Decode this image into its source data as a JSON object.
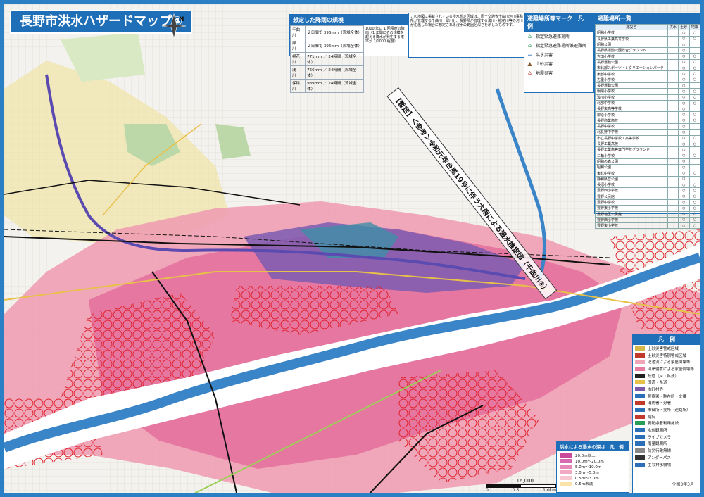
{
  "title": "長野市洪水ハザードマップ④",
  "compass_label": "N",
  "banner": "【暫定】＜参考＞令和元年台風19号に伴う大雨による浸水推定図（千曲川③）",
  "rain_table": {
    "heading": "想定した降雨の規模",
    "rows": [
      [
        "千曲川",
        "２日間で 396mm（流域全体）"
      ],
      [
        "犀　川",
        "２日間で 396mm（流域全体）"
      ],
      [
        "裾花川",
        "771mm ／ 24時間（流域全体）"
      ],
      [
        "浅　川",
        "766mm ／ 24時間（流域全体）"
      ],
      [
        "保科川",
        "989mm ／ 24時間（流域全体）"
      ]
    ],
    "side_note": "1000 年に 1 回程度の降雨（1 年間にその規模を超える降水が発生する確率が 1/1000 程度）"
  },
  "notes_text": "この地図に掲載されている浸水想定区域は、国土交通省千曲川河川事務所が管理する千曲川・犀川と、長野県が管理する浅川・裾花川等の河川が氾濫した場合に想定される浸水の範囲と深さを示したものです。",
  "mark_legend": {
    "heading": "避難場所等マーク　凡　例",
    "items": [
      {
        "label": "指定緊急避難場所",
        "icon": "shelter-icon"
      },
      {
        "label": "指定緊急避難場所兼避難所",
        "icon": "shelter-house-icon"
      }
    ],
    "types": [
      {
        "label": "洪水災害",
        "icon": "flood-icon"
      },
      {
        "label": "土砂災害",
        "icon": "landslide-icon"
      },
      {
        "label": "地震災害",
        "icon": "earthquake-icon"
      }
    ]
  },
  "shelter_list": {
    "heading": "避難場所一覧",
    "columns": [
      "施設名",
      "洪水",
      "土砂",
      "地震"
    ],
    "rows": [
      [
        "昭和小学校",
        "",
        "○",
        "○"
      ],
      [
        "長野県工業高等学校",
        "",
        "○",
        "○"
      ],
      [
        "昭和公園",
        "",
        "○",
        ""
      ],
      [
        "長野県運動公園総合グラウンド",
        "",
        "○",
        ""
      ],
      [
        "吉田小学校",
        "",
        "○",
        "○"
      ],
      [
        "長野運動公園",
        "",
        "○",
        "○"
      ],
      [
        "市北部スポーツ・レクリエーションパーク",
        "",
        "○",
        "○"
      ],
      [
        "東部中学校",
        "",
        "○",
        "○"
      ],
      [
        "古里小学校",
        "",
        "○",
        "○"
      ],
      [
        "長野運動公園",
        "",
        "○",
        ""
      ],
      [
        "朝陽小学校",
        "",
        "○",
        "○"
      ],
      [
        "浅川小学校",
        "",
        "○",
        "○"
      ],
      [
        "北部中学校",
        "",
        "○",
        "○"
      ],
      [
        "長野東高等学校",
        "",
        "○",
        ""
      ],
      [
        "柳原小学校",
        "",
        "○",
        "○"
      ],
      [
        "長野商業高校",
        "",
        "○",
        "○"
      ],
      [
        "長野中学校",
        "",
        "○",
        ""
      ],
      [
        "北長野中学校",
        "",
        "○",
        ""
      ],
      [
        "市立長野中学校・高等学校",
        "",
        "○",
        "○"
      ],
      [
        "長野工業高校",
        "",
        "○",
        "○"
      ],
      [
        "長野工業高等専門学校グラウンド",
        "",
        "○",
        ""
      ],
      [
        "三輪小学校",
        "",
        "○",
        "○"
      ],
      [
        "昭和の森公園",
        "",
        "○",
        ""
      ],
      [
        "昭和公園",
        "",
        "○",
        ""
      ],
      [
        "東北中学校",
        "",
        "○",
        "○"
      ],
      [
        "静和県営公園",
        "",
        "○",
        ""
      ],
      [
        "長沼小学校",
        "",
        "○",
        "○"
      ],
      [
        "豊野西小学校",
        "",
        "○",
        "○"
      ],
      [
        "豊野公民館",
        "",
        "○",
        "○"
      ],
      [
        "豊野中学校",
        "",
        "○",
        "○"
      ],
      [
        "豊野東小学校",
        "",
        "○",
        "○"
      ],
      [
        "豊野地区公民館",
        "",
        "○",
        "○"
      ],
      [
        "豊野西小学校",
        "",
        "○",
        "○"
      ],
      [
        "豊野東小学校",
        "",
        "○",
        "○"
      ]
    ]
  },
  "map_legend": {
    "heading": "凡　例",
    "items": [
      {
        "label": "土砂災害警戒区域",
        "color": "#d4b84a"
      },
      {
        "label": "土砂災害特別警戒区域",
        "color": "#c0392b"
      },
      {
        "label": "氾濫流による家屋倒壊等",
        "color": "#f0a6b6"
      },
      {
        "label": "河岸侵食による家屋倒壊等",
        "color": "#e77aa0"
      },
      {
        "label": "鉄道（JR・私鉄）",
        "color": "#222222"
      },
      {
        "label": "国道・県道",
        "color": "#e7c04a"
      },
      {
        "label": "市町村界",
        "color": "#7a5aa8"
      },
      {
        "label": "警察署・駐在所・交番",
        "color": "#2a6fb8"
      },
      {
        "label": "消防署・分署",
        "color": "#c0392b"
      },
      {
        "label": "市役所・支所（連絡所）",
        "color": "#2a6fb8"
      },
      {
        "label": "病院",
        "color": "#c0392b"
      },
      {
        "label": "要配慮者利用施設",
        "color": "#2a9d5a"
      },
      {
        "label": "水位観測所",
        "color": "#2a6fb8"
      },
      {
        "label": "ライブカメラ",
        "color": "#2a6fb8"
      },
      {
        "label": "雨量観測所",
        "color": "#2a6fb8"
      },
      {
        "label": "防災行政無線",
        "color": "#888888"
      },
      {
        "label": "アンダーパス",
        "color": "#333333"
      },
      {
        "label": "主な排水機場",
        "color": "#2a6fb8"
      }
    ]
  },
  "depth_legend": {
    "heading": "洪水による浸水の深さ　凡　例",
    "levels": [
      {
        "label": "20.0m以上",
        "color": "#c94a9a"
      },
      {
        "label": "10.0m〜20.0m",
        "color": "#d56ab0"
      },
      {
        "label": "5.0m〜10.0m",
        "color": "#e58ab8"
      },
      {
        "label": "3.0m〜5.0m",
        "color": "#f2aac4"
      },
      {
        "label": "0.5m〜3.0m",
        "color": "#f7c8d2"
      },
      {
        "label": "0.5m未満",
        "color": "#f9e3a8"
      }
    ]
  },
  "scale": {
    "ratio": "1：16,000",
    "marks": [
      "0",
      "0.5",
      "1.0km"
    ]
  },
  "date_note": "令和3年3月",
  "colors": {
    "frame": "#2b7fc4",
    "river": "#3a84c8",
    "flood_pink": "#e9859e",
    "flood_deep": "#8a5aa8"
  }
}
